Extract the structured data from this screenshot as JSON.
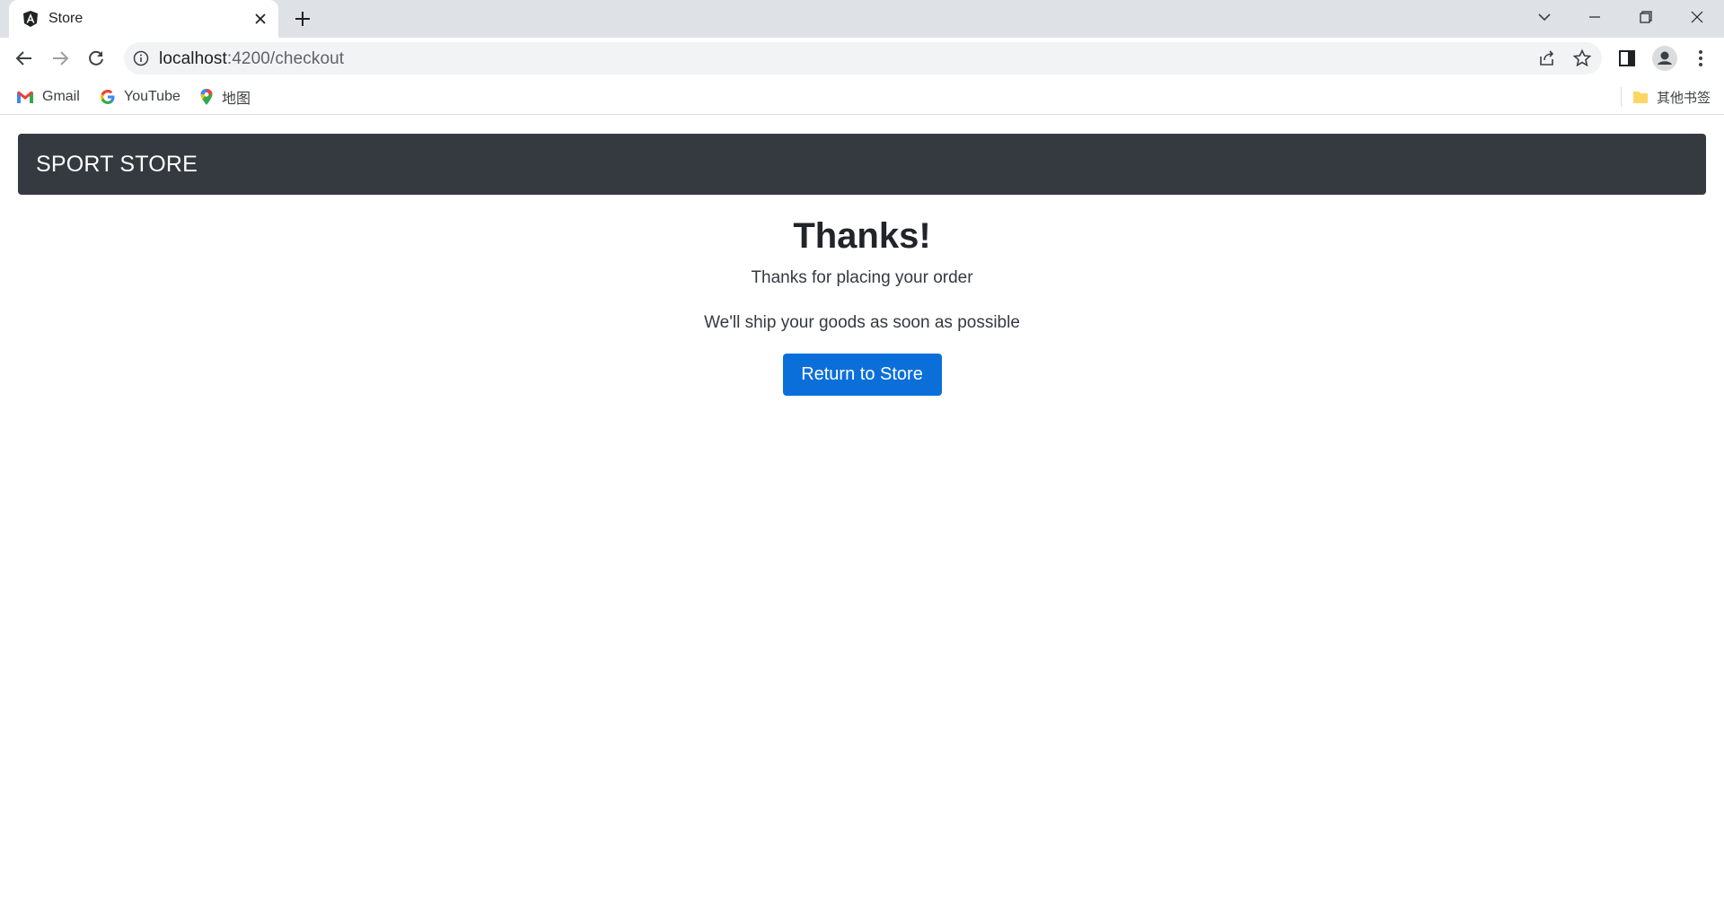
{
  "browser": {
    "tab_title": "Store",
    "url_host": "localhost",
    "url_path": ":4200/checkout",
    "bookmarks": [
      {
        "label": "Gmail",
        "icon": "gmail-icon"
      },
      {
        "label": "YouTube",
        "icon": "google-icon"
      },
      {
        "label": "地图",
        "icon": "maps-pin-icon"
      }
    ],
    "other_bookmarks": "其他书签",
    "colors": {
      "tabstrip": "#dee1e6",
      "omnibox": "#f1f3f4"
    }
  },
  "page": {
    "brand": "SPORT STORE",
    "heading": "Thanks!",
    "line1": "Thanks for placing your order",
    "line2": "We'll ship your goods as soon as possible",
    "button_label": "Return to Store",
    "colors": {
      "navbar": "#343a40",
      "button": "#0b6fd9",
      "text": "#212529"
    }
  }
}
